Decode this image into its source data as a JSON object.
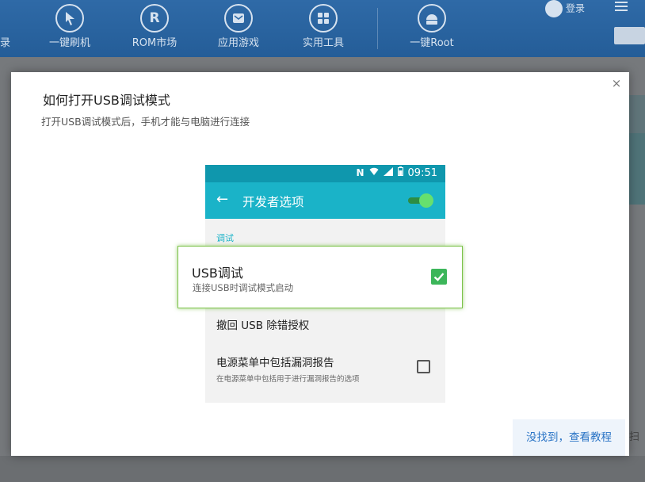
{
  "app": {
    "left_label": "录",
    "nav": [
      {
        "label": "一键刷机",
        "icon": "cursor-arrow-icon"
      },
      {
        "label": "ROM市场",
        "icon": "rom-r-icon",
        "glyph": "R"
      },
      {
        "label": "应用游戏",
        "icon": "mail-icon"
      },
      {
        "label": "实用工具",
        "icon": "grid-tools-icon"
      },
      {
        "label": "一键Root",
        "icon": "android-icon"
      }
    ],
    "login_label": "登录",
    "bottom_right_text": "扫"
  },
  "modal": {
    "close_glyph": "×",
    "title": "如何打开USB调试模式",
    "subtitle": "打开USB调试模式后，手机才能与电脑进行连接",
    "phone": {
      "time": "09:51",
      "status_nfc": "N",
      "header_title": "开发者选项",
      "back_glyph": "←",
      "section_label": "调试",
      "usb_debug": {
        "title": "USB调试",
        "description": "连接USB时调试模式启动"
      },
      "revoke_row": "撤回 USB 除错授权",
      "bug_report": {
        "title": "电源菜单中包括漏洞报告",
        "description": "在电源菜单中包括用于进行漏洞报告的选项"
      }
    },
    "tutorial_link": "没找到，查看教程"
  },
  "colors": {
    "topbar": "#2f6aa7",
    "phone_statusbar": "#0f97ad",
    "phone_appbar": "#1ab3c8",
    "highlight_border": "#7cc24a",
    "checkbox_checked": "#3cb65a",
    "link": "#2a74c6"
  }
}
